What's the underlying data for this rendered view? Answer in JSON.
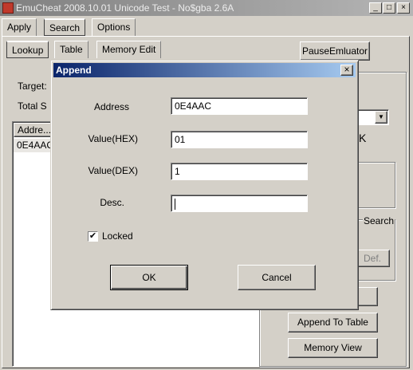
{
  "window": {
    "title": "EmuCheat 2008.10.01 Unicode Test - No$gba 2.6A",
    "minimize": "_",
    "maximize": "□",
    "close": "×"
  },
  "menu_tabs": [
    "Apply",
    "Search",
    "Options"
  ],
  "sub_tabs": [
    "Lookup",
    "Table",
    "Memory Edit"
  ],
  "pause_button": "PauseEmluator",
  "background": {
    "target_label": "Target:",
    "total_label": "Total S",
    "list_header": "Addre...",
    "list_row": "0E4AAC",
    "search_label": "Search",
    "def_button": "Def.",
    "append_to_table": "Append To Table",
    "memory_view": "Memory View"
  },
  "dialog": {
    "title": "Append",
    "close": "×",
    "address_label": "Address",
    "address_value": "0E4AAC",
    "value_hex_label": "Value(HEX)",
    "value_hex_value": "01",
    "value_dex_label": "Value(DEX)",
    "value_dex_value": "1",
    "desc_label": "Desc.",
    "desc_value": "",
    "locked_label": "Locked",
    "locked_checked": true,
    "ok": "OK",
    "cancel": "Cancel"
  }
}
